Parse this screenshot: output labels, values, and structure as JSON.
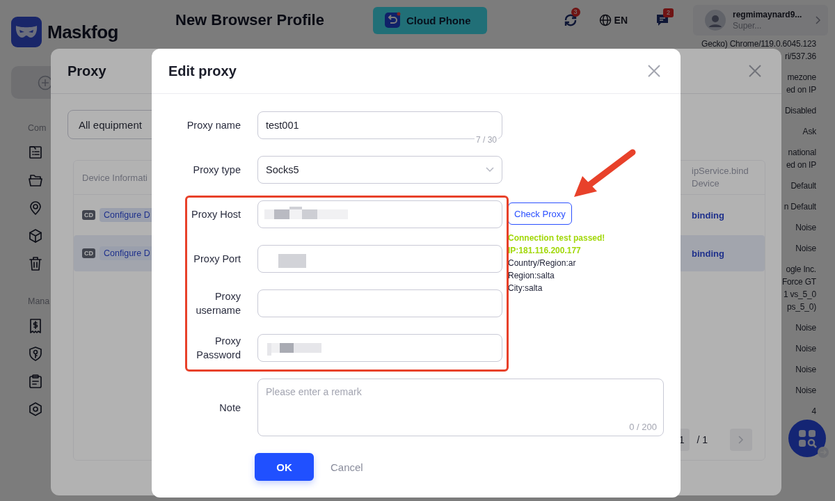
{
  "sidebar": {
    "logo": "Maskfog",
    "sections": [
      {
        "label": "Com",
        "items": [
          {
            "kind": "list"
          },
          {
            "kind": "folder"
          },
          {
            "kind": "pin"
          },
          {
            "kind": "cube"
          },
          {
            "kind": "trash"
          }
        ]
      },
      {
        "label": "Mana",
        "items": [
          {
            "kind": "receipt"
          },
          {
            "kind": "shield"
          },
          {
            "kind": "clipboard"
          },
          {
            "kind": "hexagon"
          }
        ]
      }
    ]
  },
  "topbar": {
    "title": "New Browser Profile",
    "promo": "Cloud Phone",
    "sync_badge": "3",
    "language": "EN",
    "messages_badge": "2",
    "user": {
      "name": "regmimaynard9...",
      "role": "Super..."
    }
  },
  "details": [
    {
      "lines": [
        "Gecko) Chrome/119.0.6045.123",
        "ri/537.36"
      ]
    },
    {
      "lines": [
        "mezone",
        "ed on IP"
      ]
    },
    {
      "lines": [
        "Disabled"
      ]
    },
    {
      "lines": [
        "Ask"
      ]
    },
    {
      "lines": [
        "national",
        "ed on IP"
      ]
    },
    {
      "lines": [
        "Default"
      ]
    },
    {
      "lines": [
        "n Default"
      ]
    },
    {
      "lines": [
        "Noise"
      ]
    },
    {
      "lines": [
        "Noise"
      ]
    },
    {
      "lines": [
        "ogle Inc.",
        "Force GT",
        "1 vs_5_0",
        "ps_5_0)"
      ]
    },
    {
      "lines": [
        "Noise"
      ]
    },
    {
      "lines": [
        "Noise"
      ]
    },
    {
      "lines": [
        "Noise"
      ]
    },
    {
      "lines": [
        "Noise"
      ]
    },
    {
      "lines": [
        "4"
      ]
    }
  ],
  "proxy_panel": {
    "title": "Proxy",
    "filter": "All equipment",
    "table": {
      "columns": [
        "Device Informati",
        "ipService.bind Device"
      ],
      "rows": [
        {
          "badge": "CD",
          "tag": "Configure D",
          "binding": "binding",
          "selected": false
        },
        {
          "badge": "CD",
          "tag": "Configure D",
          "binding": "binding",
          "selected": true
        }
      ]
    },
    "pagination": {
      "page": "1",
      "total": "/ 1"
    }
  },
  "dialog": {
    "title": "Edit proxy",
    "fields": [
      {
        "label": "Proxy name",
        "kind": "text",
        "value": "test001",
        "counter": "7 / 30"
      },
      {
        "label": "Proxy type",
        "kind": "select",
        "value": "Socks5"
      },
      {
        "label": "Proxy Host",
        "kind": "text",
        "redacted": true
      },
      {
        "label": "Proxy Port",
        "kind": "text",
        "redacted": true
      },
      {
        "label": "Proxy username",
        "kind": "text"
      },
      {
        "label": "Proxy Password",
        "kind": "text",
        "redacted": true
      },
      {
        "label": "Note",
        "kind": "textarea",
        "placeholder": "Please enter a remark",
        "counter": "0 / 200"
      }
    ],
    "check_button": "Check Proxy",
    "result": {
      "status": "Connection test passed!",
      "ip": "IP:181.116.200.177",
      "details": [
        "Country/Region:ar",
        "Region:salta",
        "City:salta"
      ]
    },
    "buttons": {
      "ok": "OK",
      "cancel": "Cancel"
    },
    "annotations": {
      "highlight_box": true,
      "arrow": true
    }
  }
}
